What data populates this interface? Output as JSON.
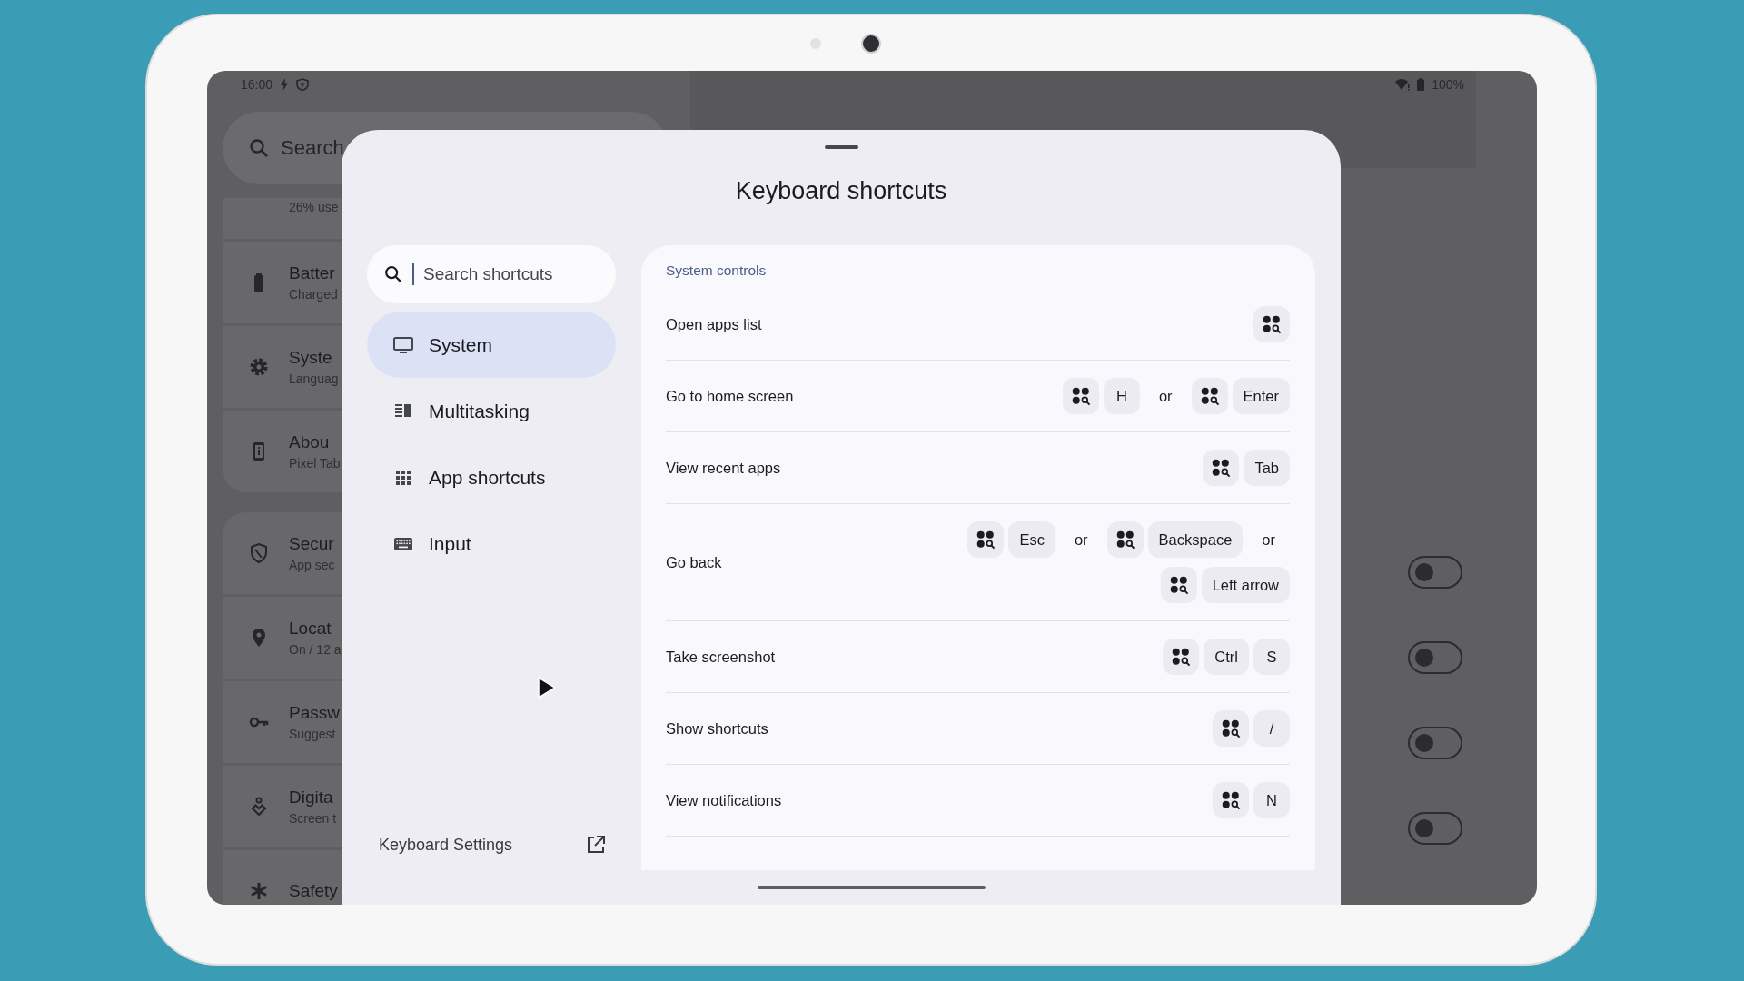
{
  "status_bar": {
    "time": "16:00",
    "battery": "100%"
  },
  "background_settings": {
    "search": {
      "placeholder": "Search"
    },
    "groups": [
      [
        {
          "subtitle": "26% use"
        },
        {
          "title": "Batter",
          "subtitle": "Charged"
        },
        {
          "title": "Syste",
          "subtitle": "Languag"
        },
        {
          "title": "Abou",
          "subtitle": "Pixel Tab"
        }
      ],
      [
        {
          "title": "Secur",
          "subtitle": "App sec"
        },
        {
          "title": "Locat",
          "subtitle": "On / 12 a"
        },
        {
          "title": "Passw",
          "subtitle": "Suggest"
        },
        {
          "title": "Digita",
          "subtitle": "Screen t"
        },
        {
          "title": "Safety"
        }
      ]
    ],
    "toggles": [
      {
        "on": false
      },
      {
        "on": false
      },
      {
        "on": false
      },
      {
        "on": false
      }
    ]
  },
  "sheet": {
    "title": "Keyboard shortcuts",
    "search": {
      "placeholder": "Search shortcuts"
    },
    "categories": [
      {
        "label": "System",
        "selected": true
      },
      {
        "label": "Multitasking",
        "selected": false
      },
      {
        "label": "App shortcuts",
        "selected": false
      },
      {
        "label": "Input",
        "selected": false
      }
    ],
    "settings_link": "Keyboard Settings",
    "section_title": "System controls",
    "shortcuts": [
      {
        "label": "Open apps list",
        "keys": [
          {
            "kind": "meta"
          }
        ]
      },
      {
        "label": "Go to home screen",
        "keys": [
          {
            "kind": "meta"
          },
          {
            "kind": "key",
            "text": "H"
          },
          {
            "kind": "or",
            "text": "or"
          },
          {
            "kind": "meta"
          },
          {
            "kind": "key",
            "text": "Enter"
          }
        ]
      },
      {
        "label": "View recent apps",
        "keys": [
          {
            "kind": "meta"
          },
          {
            "kind": "key",
            "text": "Tab"
          }
        ]
      },
      {
        "label": "Go back",
        "keys": [
          {
            "kind": "meta"
          },
          {
            "kind": "key",
            "text": "Esc"
          },
          {
            "kind": "or",
            "text": "or"
          },
          {
            "kind": "meta"
          },
          {
            "kind": "key",
            "text": "Backspace"
          },
          {
            "kind": "or",
            "text": "or"
          },
          {
            "kind": "meta"
          },
          {
            "kind": "key",
            "text": "Left arrow"
          }
        ]
      },
      {
        "label": "Take screenshot",
        "keys": [
          {
            "kind": "meta"
          },
          {
            "kind": "key",
            "text": "Ctrl"
          },
          {
            "kind": "key",
            "text": "S"
          }
        ]
      },
      {
        "label": "Show shortcuts",
        "keys": [
          {
            "kind": "meta"
          },
          {
            "kind": "key",
            "text": "/"
          }
        ]
      },
      {
        "label": "View notifications",
        "keys": [
          {
            "kind": "meta"
          },
          {
            "kind": "key",
            "text": "N"
          }
        ]
      }
    ]
  }
}
